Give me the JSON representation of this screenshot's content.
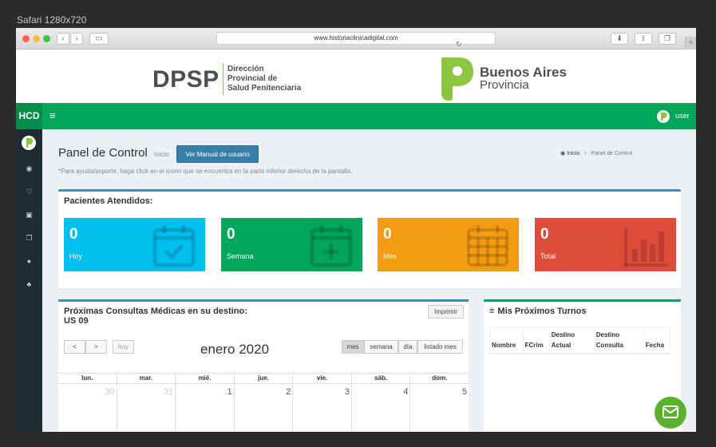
{
  "window_label": "Safari 1280x720",
  "browser": {
    "url": "www.historiaclinicadigital.com"
  },
  "banner": {
    "dpsp": "DPSP",
    "dpsp_sub": [
      "Dirección",
      "Provincial de",
      "Salud Penitenciaria"
    ],
    "ba_line1": "Buenos Aires",
    "ba_line2": "Provincia"
  },
  "topnav": {
    "brand": "HCD",
    "user": "user"
  },
  "page_header": {
    "title": "Panel de Control",
    "subtitle": "Inicio",
    "manual_button": "Ver Manual de usuario",
    "help_text": "*Para ayuda/soporte, haga click en el ícono que se encuentra en la parte inferior derecha de la pantalla.",
    "breadcrumb": {
      "home": "Inicio",
      "current": "Panel de Control"
    }
  },
  "pacientes": {
    "title": "Pacientes Atendidos:",
    "boxes": [
      {
        "value": "0",
        "label": "Hoy",
        "color": "#00c0ef"
      },
      {
        "value": "0",
        "label": "Semana",
        "color": "#00a65a"
      },
      {
        "value": "0",
        "label": "Mes",
        "color": "#f39c12"
      },
      {
        "value": "0",
        "label": "Total",
        "color": "#dd4b39"
      }
    ]
  },
  "consultas": {
    "title_line1": "Próximas Consultas Médicas en su destino:",
    "title_line2": "US 09",
    "print_button": "Imprimir",
    "prev": "<",
    "next": ">",
    "today": "hoy",
    "month_title": "enero 2020",
    "views": [
      "mes",
      "semana",
      "día",
      "listado mes"
    ],
    "weekdays": [
      "lun.",
      "mar.",
      "mié.",
      "jue.",
      "vie.",
      "sáb.",
      "dom."
    ],
    "first_row": [
      "30",
      "31",
      "1",
      "2",
      "3",
      "4",
      "5"
    ]
  },
  "turnos": {
    "title": "Mis Próximos Turnos",
    "columns": [
      "Nombre",
      "FCrim",
      "Destino Actual",
      "Destino Consulta",
      "Fecha"
    ]
  },
  "colors": {
    "green": "#00a65a",
    "blue": "#3c8dbc",
    "sidebar": "#1f2d33"
  }
}
